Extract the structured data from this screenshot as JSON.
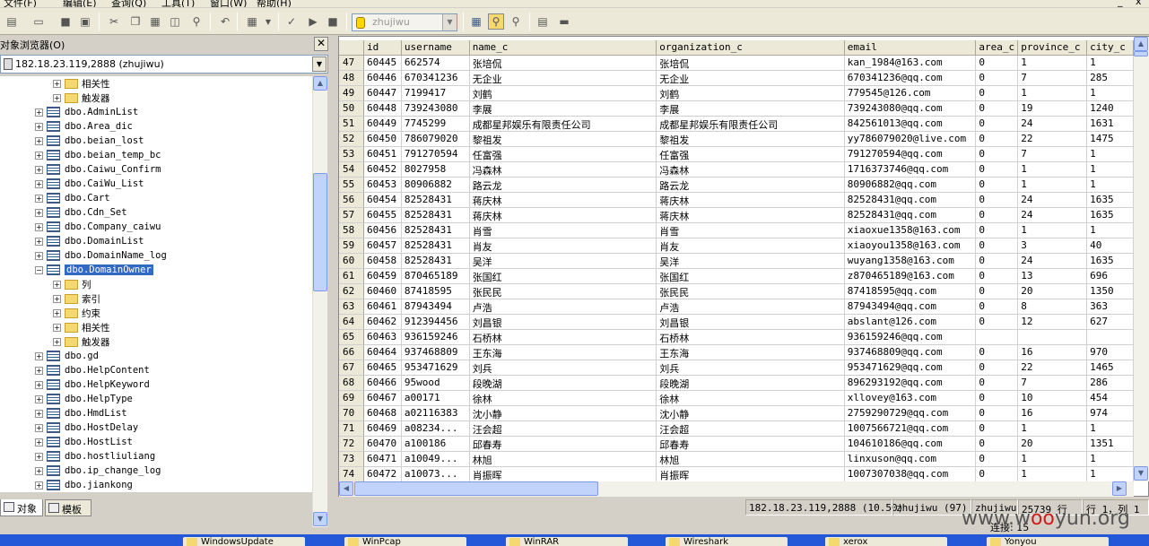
{
  "menu": {
    "items": [
      "文件(F)",
      "编辑(E)",
      "查询(Q)",
      "工具(T)",
      "窗口(W)",
      "帮助(H)"
    ]
  },
  "toolbar": {
    "database": "zhujiwu",
    "icons": [
      "new-icon",
      "open-icon",
      "save-icon",
      "save-all-icon",
      "cut-icon",
      "copy-icon",
      "paste-icon",
      "clear-icon",
      "find-icon",
      "undo-icon",
      "grid-icon",
      "check-icon",
      "run-icon",
      "stop-icon",
      "object-browser-icon",
      "object-search-icon",
      "show-plan-icon",
      "results-icon"
    ]
  },
  "object_browser": {
    "title": "对象浏览器(O)",
    "server": "182.18.23.119,2888 (zhujiwu)",
    "tree": [
      {
        "label": "相关性",
        "kind": "folder",
        "level": 2
      },
      {
        "label": "触发器",
        "kind": "folder",
        "level": 2
      },
      {
        "label": "dbo.AdminList",
        "kind": "table",
        "level": 1
      },
      {
        "label": "dbo.Area_dic",
        "kind": "table",
        "level": 1
      },
      {
        "label": "dbo.beian_lost",
        "kind": "table",
        "level": 1
      },
      {
        "label": "dbo.beian_temp_bc",
        "kind": "table",
        "level": 1
      },
      {
        "label": "dbo.Caiwu_Confirm",
        "kind": "table",
        "level": 1
      },
      {
        "label": "dbo.CaiWu_List",
        "kind": "table",
        "level": 1
      },
      {
        "label": "dbo.Cart",
        "kind": "table",
        "level": 1
      },
      {
        "label": "dbo.Cdn_Set",
        "kind": "table",
        "level": 1
      },
      {
        "label": "dbo.Company_caiwu",
        "kind": "table",
        "level": 1
      },
      {
        "label": "dbo.DomainList",
        "kind": "table",
        "level": 1
      },
      {
        "label": "dbo.DomainName_log",
        "kind": "table",
        "level": 1
      },
      {
        "label": "dbo.DomainOwner",
        "kind": "table",
        "level": 1,
        "expanded": true,
        "selected": true
      },
      {
        "label": "列",
        "kind": "folder",
        "level": 2
      },
      {
        "label": "索引",
        "kind": "folder",
        "level": 2
      },
      {
        "label": "约束",
        "kind": "folder",
        "level": 2
      },
      {
        "label": "相关性",
        "kind": "folder",
        "level": 2
      },
      {
        "label": "触发器",
        "kind": "folder",
        "level": 2
      },
      {
        "label": "dbo.gd",
        "kind": "table",
        "level": 1
      },
      {
        "label": "dbo.HelpContent",
        "kind": "table",
        "level": 1
      },
      {
        "label": "dbo.HelpKeyword",
        "kind": "table",
        "level": 1
      },
      {
        "label": "dbo.HelpType",
        "kind": "table",
        "level": 1
      },
      {
        "label": "dbo.HmdList",
        "kind": "table",
        "level": 1
      },
      {
        "label": "dbo.HostDelay",
        "kind": "table",
        "level": 1
      },
      {
        "label": "dbo.HostList",
        "kind": "table",
        "level": 1
      },
      {
        "label": "dbo.hostliuliang",
        "kind": "table",
        "level": 1
      },
      {
        "label": "dbo.ip_change_log",
        "kind": "table",
        "level": 1
      },
      {
        "label": "dbo.jiankong",
        "kind": "table",
        "level": 1
      }
    ],
    "tabs": [
      "对象",
      "模板"
    ]
  },
  "grid": {
    "columns": [
      "id",
      "username",
      "name_c",
      "organization_c",
      "email",
      "area_c",
      "province_c",
      "city_c"
    ],
    "rows": [
      [
        "47",
        "60445",
        "662574",
        "张培侃",
        "张培侃",
        "kan_1984@163.com",
        "0",
        "1",
        "1"
      ],
      [
        "48",
        "60446",
        "670341236",
        "无企业",
        "无企业",
        "670341236@qq.com",
        "0",
        "7",
        "285"
      ],
      [
        "49",
        "60447",
        "7199417",
        "刘鹤",
        "刘鹤",
        "779545@126.com",
        "0",
        "1",
        "1"
      ],
      [
        "50",
        "60448",
        "739243080",
        "李展",
        "李展",
        "739243080@qq.com",
        "0",
        "19",
        "1240"
      ],
      [
        "51",
        "60449",
        "7745299",
        "成都星邦娱乐有限责任公司",
        "成都星邦娱乐有限责任公司",
        "842561013@qq.com",
        "0",
        "24",
        "1631"
      ],
      [
        "52",
        "60450",
        "786079020",
        "黎祖发",
        "黎祖发",
        "yy786079020@live.com",
        "0",
        "22",
        "1475"
      ],
      [
        "53",
        "60451",
        "791270594",
        "任富强",
        "任富强",
        "791270594@qq.com",
        "0",
        "7",
        "1"
      ],
      [
        "54",
        "60452",
        "8027958",
        "冯森林",
        "冯森林",
        "1716373746@qq.com",
        "0",
        "1",
        "1"
      ],
      [
        "55",
        "60453",
        "80906882",
        "路云龙",
        "路云龙",
        "80906882@qq.com",
        "0",
        "1",
        "1"
      ],
      [
        "56",
        "60454",
        "82528431",
        "蒋庆林",
        "蒋庆林",
        "82528431@qq.com",
        "0",
        "24",
        "1635"
      ],
      [
        "57",
        "60455",
        "82528431",
        "蒋庆林",
        "蒋庆林",
        "82528431@qq.com",
        "0",
        "24",
        "1635"
      ],
      [
        "58",
        "60456",
        "82528431",
        "肖雪",
        "肖雪",
        "xiaoxue1358@163.com",
        "0",
        "1",
        "1"
      ],
      [
        "59",
        "60457",
        "82528431",
        "肖友",
        "肖友",
        "xiaoyou1358@163.com",
        "0",
        "3",
        "40"
      ],
      [
        "60",
        "60458",
        "82528431",
        "吴洋",
        "吴洋",
        "wuyang1358@163.com",
        "0",
        "24",
        "1635"
      ],
      [
        "61",
        "60459",
        "870465189",
        "张国红",
        "张国红",
        "z870465189@163.com",
        "0",
        "13",
        "696"
      ],
      [
        "62",
        "60460",
        "87418595",
        "张民民",
        "张民民",
        "87418595@qq.com",
        "0",
        "20",
        "1350"
      ],
      [
        "63",
        "60461",
        "87943494",
        "卢浩",
        "卢浩",
        "87943494@qq.com",
        "0",
        "8",
        "363"
      ],
      [
        "64",
        "60462",
        "912394456",
        "刘昌银",
        "刘昌银",
        "abslant@126.com",
        "0",
        "12",
        "627"
      ],
      [
        "65",
        "60463",
        "936159246",
        "石桥林",
        "石桥林",
        "936159246@qq.com",
        "",
        "",
        ""
      ],
      [
        "66",
        "60464",
        "937468809",
        "王东海",
        "王东海",
        "937468809@qq.com",
        "0",
        "16",
        "970"
      ],
      [
        "67",
        "60465",
        "953471629",
        "刘兵",
        "刘兵",
        "953471629@qq.com",
        "0",
        "22",
        "1465"
      ],
      [
        "68",
        "60466",
        "95wood",
        "段晚湖",
        "段晚湖",
        "896293192@qq.com",
        "0",
        "7",
        "286"
      ],
      [
        "69",
        "60467",
        "a00171",
        "徐林",
        "徐林",
        "xllovey@163.com",
        "0",
        "10",
        "454"
      ],
      [
        "70",
        "60468",
        "a02116383",
        "沈小静",
        "沈小静",
        "2759290729@qq.com",
        "0",
        "16",
        "974"
      ],
      [
        "71",
        "60469",
        "a08234...",
        "汪会超",
        "汪会超",
        "1007566721@qq.com",
        "0",
        "1",
        "1"
      ],
      [
        "72",
        "60470",
        "a100186",
        "邱春寿",
        "邱春寿",
        "104610186@qq.com",
        "0",
        "20",
        "1351"
      ],
      [
        "73",
        "60471",
        "a10049...",
        "林旭",
        "林旭",
        "linxuson@qq.com",
        "0",
        "1",
        "1"
      ],
      [
        "74",
        "60472",
        "a10073...",
        "肖振晖",
        "肖振晖",
        "1007307038@qq.com",
        "0",
        "1",
        "1"
      ]
    ]
  },
  "status": {
    "server": "182.18.23.119,2888 (10.50)",
    "user": "zhujiwu (97)",
    "database": "zhujiwu",
    "rows": "25739 行",
    "position": "行 1，列 1",
    "connections": "连接: 15"
  },
  "taskbar": {
    "items": [
      "WindowsUpdate",
      "WinPcap",
      "WinRAR",
      "Wireshark",
      "xerox",
      "Yonyou"
    ]
  },
  "watermark": {
    "prefix": "www.w",
    "o1": "o",
    "o2": "o",
    "suffix": "yun.org"
  }
}
